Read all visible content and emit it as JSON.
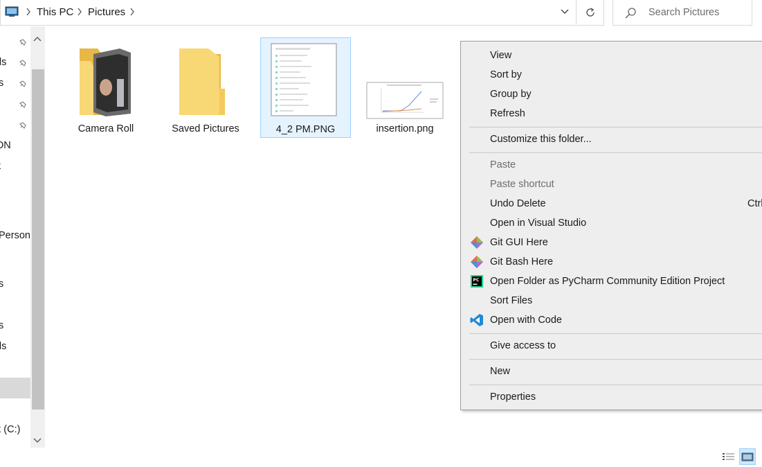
{
  "address": {
    "crumbs": [
      "This PC",
      "Pictures"
    ]
  },
  "search": {
    "placeholder": "Search Pictures"
  },
  "nav": {
    "items": [
      {
        "label": "ds"
      },
      {
        "label": "ts"
      },
      {
        "label": "ON"
      },
      {
        "label": "k"
      },
      {
        "label": "Person"
      },
      {
        "label": "ts"
      },
      {
        "label": "ts"
      },
      {
        "label": "ds"
      },
      {
        "label": "k (C:)"
      }
    ]
  },
  "files": [
    {
      "name": "Camera Roll",
      "icon": "folder-with-photo-icon"
    },
    {
      "name": "Saved Pictures",
      "icon": "folder-icon"
    },
    {
      "name": "4_2 PM.PNG",
      "icon": "image-thumbnail-icon"
    },
    {
      "name": "insertion.png",
      "icon": "chart-thumbnail-icon"
    }
  ],
  "context_menu": {
    "view": "View",
    "sort_by": "Sort by",
    "group_by": "Group by",
    "refresh": "Refresh",
    "customize": "Customize this folder...",
    "paste": "Paste",
    "paste_shortcut": "Paste shortcut",
    "undo_delete": "Undo Delete",
    "undo_shortcut": "Ctrl",
    "open_vs": "Open in Visual Studio",
    "git_gui": "Git GUI Here",
    "git_bash": "Git Bash Here",
    "pycharm": "Open Folder as PyCharm Community Edition Project",
    "sort_files": "Sort Files",
    "open_code": "Open with Code",
    "give_access": "Give access to",
    "new": "New",
    "properties": "Properties"
  },
  "colors": {
    "accent": "#0078d7",
    "selection_bg": "#e5f3ff",
    "selection_border": "#99d1ff",
    "menu_bg": "#eeeeee",
    "folder_yellow": "#f8d775"
  }
}
